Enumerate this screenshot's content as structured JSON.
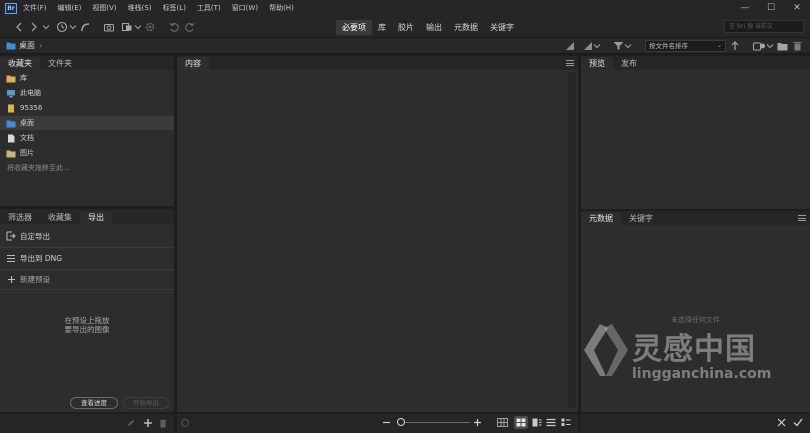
{
  "app": {
    "logo_text": "Br"
  },
  "menu": [
    "文件(F)",
    "编辑(E)",
    "视图(V)",
    "堆栈(S)",
    "标签(L)",
    "工具(T)",
    "窗口(W)",
    "帮助(H)"
  ],
  "window_controls": [
    "—",
    "☐",
    "✕"
  ],
  "workspaces": [
    "必要项",
    "库",
    "胶片",
    "输出",
    "元数据",
    "关键字"
  ],
  "active_workspace": "必要项",
  "search": {
    "placeholder": "在 Bri 搜 当前文"
  },
  "path": {
    "current": "桌面",
    "arrow": "›"
  },
  "sort": {
    "selected": "按文件名排序",
    "chevron": "⌄"
  },
  "favorites_panel": {
    "tabs": [
      "收藏夹",
      "文件夹"
    ],
    "items": [
      {
        "label": "库",
        "icon": "library-icon"
      },
      {
        "label": "此电脑",
        "icon": "computer-icon"
      },
      {
        "label": "95356",
        "icon": "user-icon"
      },
      {
        "label": "桌面",
        "icon": "desktop-folder-icon"
      },
      {
        "label": "文档",
        "icon": "document-icon"
      },
      {
        "label": "图片",
        "icon": "picture-icon"
      }
    ],
    "hint": "将收藏夹拖移至此..."
  },
  "export_panel": {
    "tabs": [
      "筛选器",
      "收藏集",
      "导出"
    ],
    "items": [
      {
        "label": "自定导出",
        "icon": "custom-export-icon"
      },
      {
        "label": "导出到 DNG",
        "icon": "list-icon"
      },
      {
        "label": "新建预设",
        "icon": "plus-icon"
      }
    ],
    "empty_text_line1": "在预设上拖放",
    "empty_text_line2": "要导出的图像",
    "queue_button": "查看进度",
    "export_button": "开始导出"
  },
  "content_panel": {
    "tab": "内容"
  },
  "preview_panel": {
    "tabs": [
      "预览",
      "发布"
    ]
  },
  "metadata_panel": {
    "tabs": [
      "元数据",
      "关键字"
    ],
    "empty_text": "未选择任何文件"
  },
  "watermark": {
    "brand": "灵感中国",
    "url": "lingganchina.com"
  },
  "colors": {
    "selected_folder": "#3c8fdc",
    "accent": "#6fa2e8"
  }
}
